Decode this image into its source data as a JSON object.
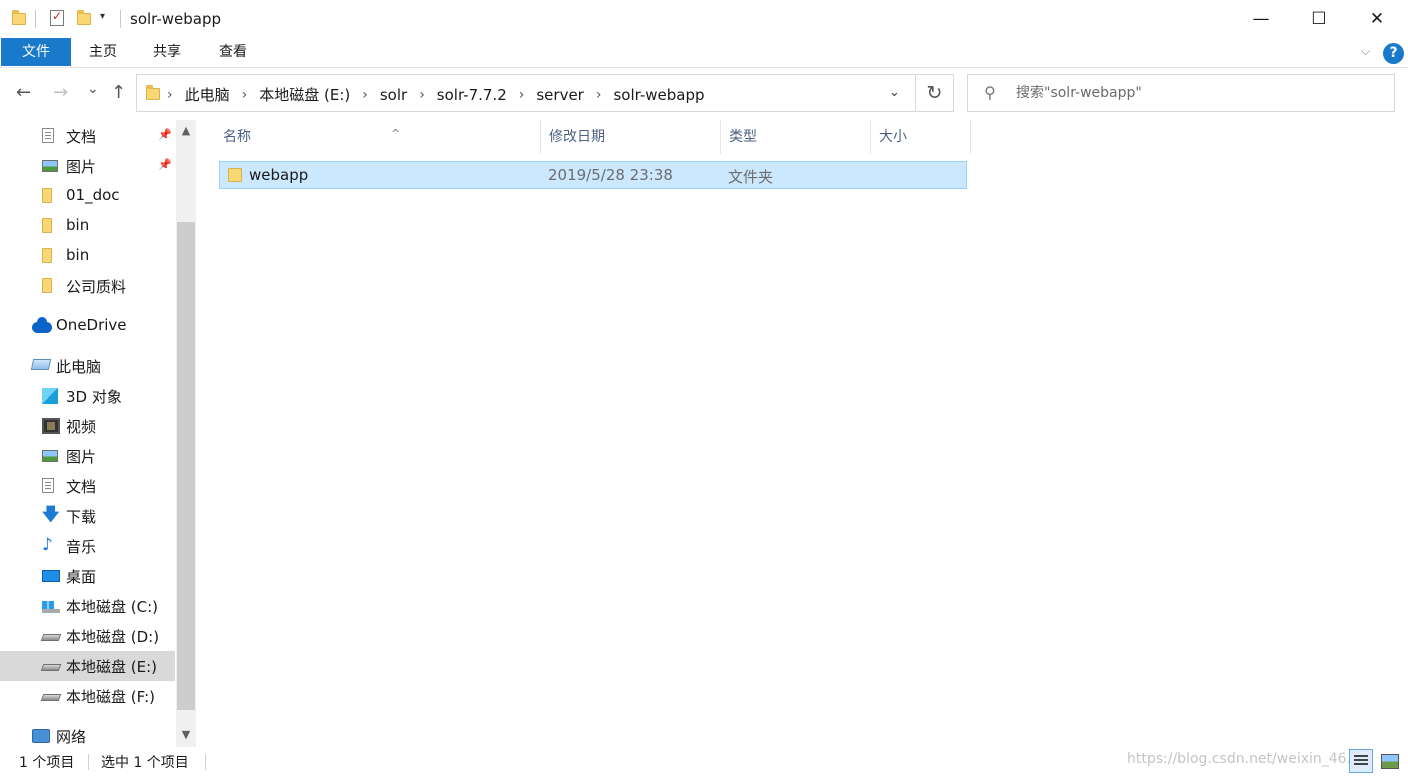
{
  "window": {
    "title": "solr-webapp",
    "minimize": "—",
    "maximize": "☐",
    "close": "✕"
  },
  "quick_access_toolbar": {
    "dropdown": "▾"
  },
  "ribbon": {
    "tabs": [
      "文件",
      "主页",
      "共享",
      "查看"
    ],
    "expand": "⌵",
    "help": "?"
  },
  "nav": {
    "back": "←",
    "forward": "→",
    "recent": "⌄",
    "up": "↑"
  },
  "address": {
    "crumbs": [
      "此电脑",
      "本地磁盘 (E:)",
      "solr",
      "solr-7.7.2",
      "server",
      "solr-webapp"
    ],
    "separator": "›",
    "dropdown": "⌄",
    "refresh": "↻"
  },
  "search": {
    "icon": "⚲",
    "placeholder": "搜索\"solr-webapp\""
  },
  "sidebar": {
    "items": [
      {
        "label": "文档",
        "icon": "document-icon",
        "pinned": true
      },
      {
        "label": "图片",
        "icon": "picture-icon",
        "pinned": true
      },
      {
        "label": "01_doc",
        "icon": "folder-icon"
      },
      {
        "label": "bin",
        "icon": "folder-icon"
      },
      {
        "label": "bin",
        "icon": "folder-icon"
      },
      {
        "label": "公司质料",
        "icon": "folder-icon"
      },
      {
        "label": "OneDrive",
        "icon": "onedrive-icon"
      },
      {
        "label": "此电脑",
        "icon": "computer-icon"
      },
      {
        "label": "3D 对象",
        "icon": "3d-objects-icon"
      },
      {
        "label": "视频",
        "icon": "video-icon"
      },
      {
        "label": "图片",
        "icon": "picture-icon"
      },
      {
        "label": "文档",
        "icon": "document-icon"
      },
      {
        "label": "下载",
        "icon": "download-icon"
      },
      {
        "label": "音乐",
        "icon": "music-icon"
      },
      {
        "label": "桌面",
        "icon": "desktop-icon"
      },
      {
        "label": "本地磁盘 (C:)",
        "icon": "system-drive-icon"
      },
      {
        "label": "本地磁盘 (D:)",
        "icon": "drive-icon"
      },
      {
        "label": "本地磁盘 (E:)",
        "icon": "drive-icon",
        "selected": true
      },
      {
        "label": "本地磁盘 (F:)",
        "icon": "drive-icon"
      },
      {
        "label": "网络",
        "icon": "network-icon"
      }
    ],
    "pin_glyph": "📌",
    "scroll_up": "▲",
    "scroll_down": "▼"
  },
  "filelist": {
    "columns": [
      "名称",
      "修改日期",
      "类型",
      "大小"
    ],
    "sort_caret": "^",
    "rows": [
      {
        "name": "webapp",
        "modified": "2019/5/28 23:38",
        "type": "文件夹",
        "size": ""
      }
    ]
  },
  "status": {
    "item_count": "1 个项目",
    "selected_count": "选中 1 个项目",
    "watermark": "https://blog.csdn.net/weixin_46..."
  },
  "colors": {
    "accent": "#1979ca",
    "selection_bg": "#cce8ff",
    "selection_border": "#99d1ff",
    "header_text": "#4d6082"
  }
}
